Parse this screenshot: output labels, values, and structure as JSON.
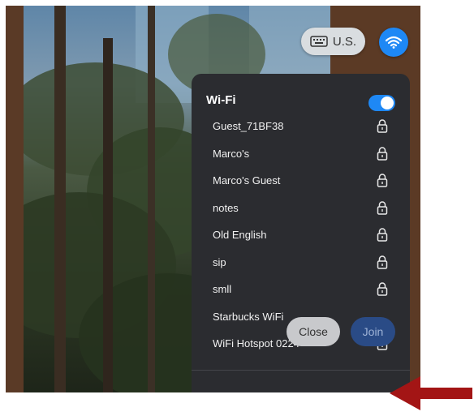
{
  "top_bar": {
    "keyboard_label": "U.S."
  },
  "wifi_panel": {
    "title": "Wi-Fi",
    "toggle_on": true,
    "networks": [
      {
        "name": "Guest_71BF38",
        "secured": true
      },
      {
        "name": "Marco's",
        "secured": true
      },
      {
        "name": "Marco's Guest",
        "secured": true
      },
      {
        "name": "notes",
        "secured": true
      },
      {
        "name": "Old English",
        "secured": true
      },
      {
        "name": "sip",
        "secured": true
      },
      {
        "name": "smll",
        "secured": true
      },
      {
        "name": "Starbucks WiFi",
        "secured": false
      },
      {
        "name": "WiFi Hotspot 0224",
        "secured": true
      }
    ],
    "close_label": "Close",
    "join_label": "Join"
  },
  "colors": {
    "accent": "#1e88f5",
    "panel_bg": "#2b2c30",
    "annotation_arrow": "#a31515"
  }
}
